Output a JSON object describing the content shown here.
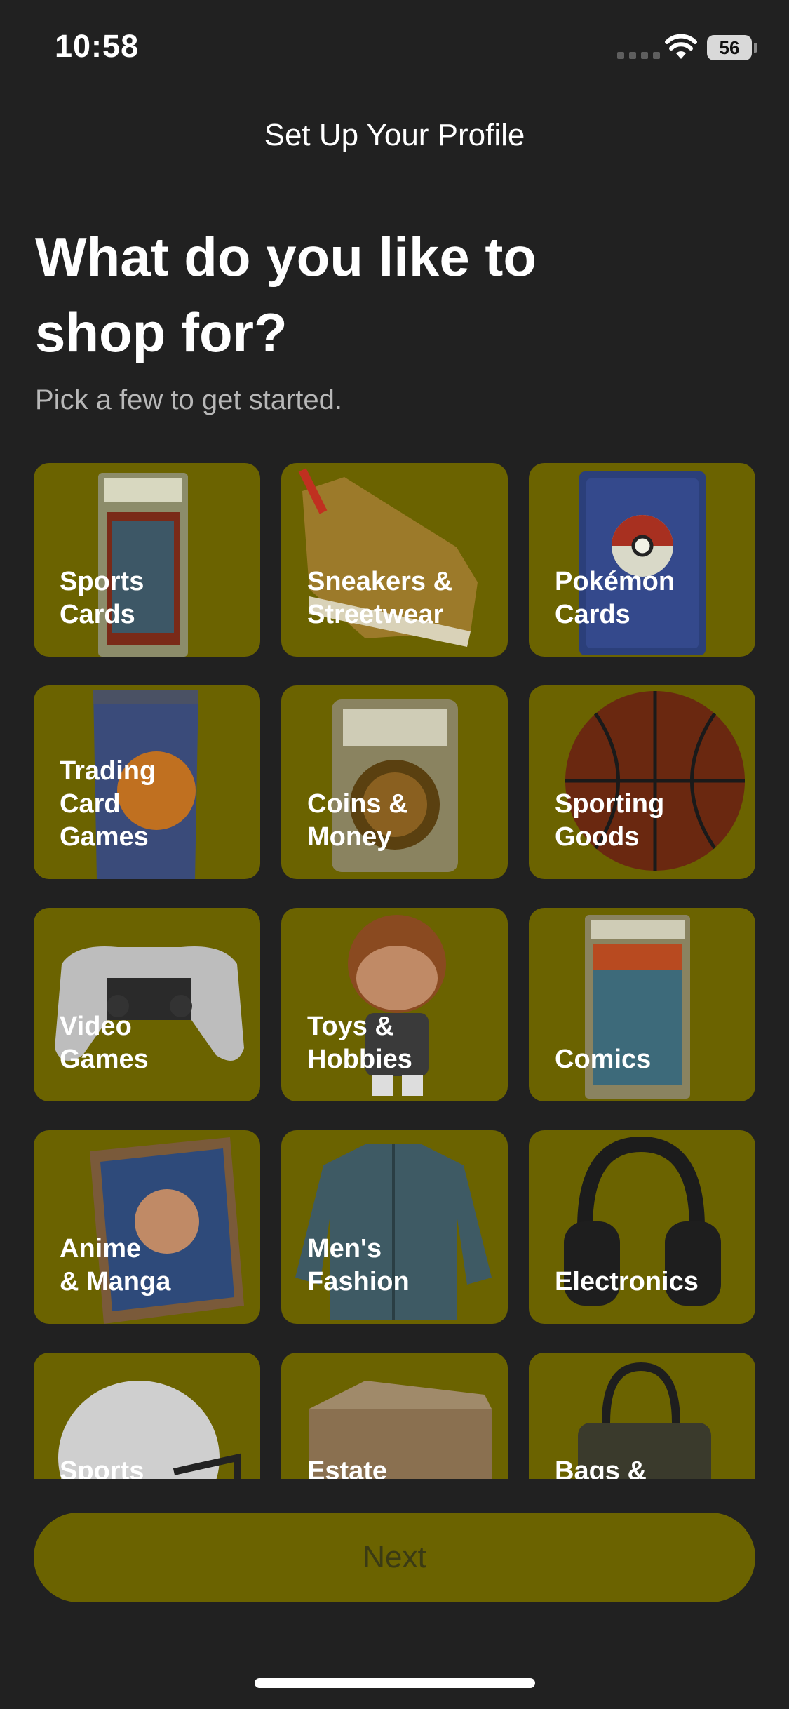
{
  "status_bar": {
    "time": "10:58",
    "battery": "56"
  },
  "screen_title": "Set Up Your Profile",
  "heading": "What do you like to shop for?",
  "subtitle": "Pick a few to get started.",
  "categories": [
    {
      "label": "Sports\nCards",
      "icon": "graded-sports-card-icon"
    },
    {
      "label": "Sneakers &\nStreetwear",
      "icon": "sneaker-icon"
    },
    {
      "label": "Pokémon\nCards",
      "icon": "pokemon-card-icon"
    },
    {
      "label": "Trading\nCard\nGames",
      "icon": "booster-pack-icon"
    },
    {
      "label": "Coins &\nMoney",
      "icon": "graded-coin-icon"
    },
    {
      "label": "Sporting\nGoods",
      "icon": "basketball-icon"
    },
    {
      "label": "Video\nGames",
      "icon": "game-controller-icon"
    },
    {
      "label": "Toys &\nHobbies",
      "icon": "vinyl-figure-icon"
    },
    {
      "label": "Comics",
      "icon": "graded-comic-icon"
    },
    {
      "label": "Anime\n& Manga",
      "icon": "manga-volume-icon"
    },
    {
      "label": "Men's\nFashion",
      "icon": "jacket-icon"
    },
    {
      "label": "Electronics",
      "icon": "headphones-icon"
    },
    {
      "label": "Sports\nMemorabili",
      "icon": "football-helmet-icon"
    },
    {
      "label": "Estate\nSales &",
      "icon": "cardboard-box-icon"
    },
    {
      "label": "Bags &\nAccessorie",
      "icon": "handbag-icon"
    }
  ],
  "next_button": "Next",
  "colors": {
    "background": "#212121",
    "tile": "#6b6300",
    "button": "#6b6300",
    "button_text": "#3a3a14"
  }
}
